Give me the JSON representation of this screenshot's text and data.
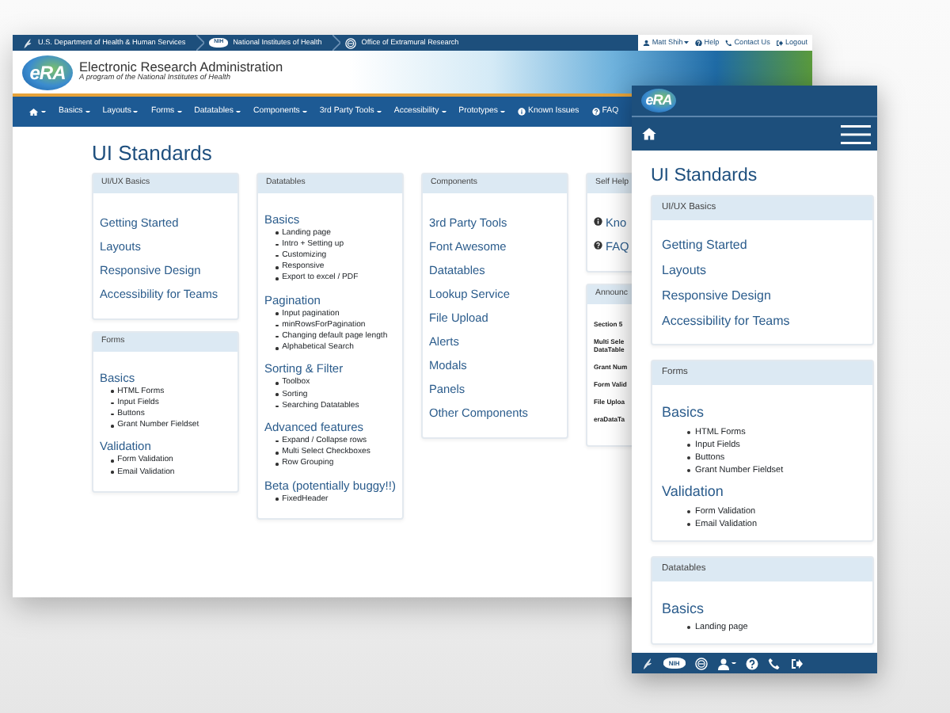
{
  "desktop": {
    "top_bar": {
      "agencies": [
        {
          "kind": "hhs",
          "name": "U.S. Department of Health & Human Services"
        },
        {
          "kind": "nih",
          "badge": "NIH",
          "name": "National Institutes of Health"
        },
        {
          "kind": "oer",
          "name": "Office of Extramural Research"
        }
      ],
      "user_links": [
        {
          "kind": "user",
          "label": "Matt Shih",
          "dropdown": true
        },
        {
          "kind": "help",
          "label": "Help",
          "dropdown": false
        },
        {
          "kind": "phone",
          "label": "Contact Us",
          "dropdown": false
        },
        {
          "kind": "logout",
          "label": "Logout",
          "dropdown": false
        }
      ]
    },
    "header": {
      "logo": "eRA",
      "title": "Electronic Research Administration",
      "subtitle": "A program of the National Institutes of Health"
    },
    "nav": [
      {
        "kind": "home",
        "dropdown": true
      },
      {
        "kind": "text",
        "label": "Basics",
        "dropdown": true
      },
      {
        "kind": "text",
        "label": "Layouts",
        "dropdown": true
      },
      {
        "kind": "text",
        "label": "Forms",
        "dropdown": true
      },
      {
        "kind": "text",
        "label": "Datatables",
        "dropdown": true
      },
      {
        "kind": "text",
        "label": "Components",
        "dropdown": true
      },
      {
        "kind": "text",
        "label": "3rd Party Tools",
        "dropdown": true
      },
      {
        "kind": "text",
        "label": "Accessibility",
        "dropdown": true
      },
      {
        "kind": "text",
        "label": "Prototypes",
        "dropdown": true
      },
      {
        "kind": "info",
        "label": "Known Issues",
        "dropdown": false
      },
      {
        "kind": "help",
        "label": "FAQ",
        "dropdown": false
      }
    ],
    "page_title": "UI Standards",
    "columns": [
      [
        {
          "title": "UI/UX Basics",
          "kind": "links",
          "links": [
            "Getting Started",
            "Layouts",
            "Responsive Design",
            "Accessibility for Teams"
          ]
        },
        {
          "title": "Forms",
          "kind": "sections",
          "sections": [
            {
              "heading": "Basics",
              "items": [
                "HTML Forms",
                "Input Fields",
                "Buttons",
                "Grant Number Fieldset"
              ]
            },
            {
              "heading": "Validation",
              "items": [
                "Form Validation",
                "Email Validation"
              ]
            }
          ]
        }
      ],
      [
        {
          "title": "Datatables",
          "kind": "sections",
          "sections": [
            {
              "heading": "Basics",
              "items": [
                "Landing page",
                "Intro + Setting up",
                "Customizing",
                "Responsive",
                "Export to excel / PDF"
              ]
            },
            {
              "heading": "Pagination",
              "items": [
                "Input pagination",
                "minRowsForPagination",
                "Changing default page length",
                "Alphabetical Search"
              ]
            },
            {
              "heading": "Sorting & Filter",
              "items": [
                "Toolbox",
                "Sorting",
                "Searching Datatables"
              ]
            },
            {
              "heading": "Advanced features",
              "items": [
                "Expand / Collapse rows",
                "Multi Select Checkboxes",
                "Row Grouping"
              ]
            },
            {
              "heading": "Beta (potentially buggy!!)",
              "items": [
                "FixedHeader"
              ]
            }
          ]
        }
      ],
      [
        {
          "title": "Components",
          "kind": "links",
          "links": [
            "3rd Party Tools",
            "Font Awesome",
            "Datatables",
            "Lookup Service",
            "File Upload",
            "Alerts",
            "Modals",
            "Panels",
            "Other Components"
          ]
        }
      ],
      [
        {
          "title": "Self Help",
          "kind": "icon_links",
          "links": [
            {
              "kind": "info",
              "label": "Kno"
            },
            {
              "kind": "help",
              "label": "FAQ"
            }
          ]
        },
        {
          "title": "Announc",
          "kind": "announcements",
          "items": [
            [
              "Section 5"
            ],
            [
              "Multi Sele",
              "DataTable"
            ],
            [
              "Grant Num"
            ],
            [
              "Form Valid"
            ],
            [
              "File Uploa"
            ],
            [
              "eraDataTa"
            ]
          ]
        }
      ]
    ]
  },
  "mobile": {
    "logo": "eRA",
    "page_title": "UI Standards",
    "cards": [
      {
        "title": "UI/UX Basics",
        "kind": "links",
        "links": [
          "Getting Started",
          "Layouts",
          "Responsive Design",
          "Accessibility for Teams"
        ]
      },
      {
        "title": "Forms",
        "kind": "sections",
        "sections": [
          {
            "heading": "Basics",
            "items": [
              "HTML Forms",
              "Input Fields",
              "Buttons",
              "Grant Number Fieldset"
            ]
          },
          {
            "heading": "Validation",
            "items": [
              "Form Validation",
              "Email Validation"
            ]
          }
        ]
      },
      {
        "title": "Datatables",
        "kind": "sections",
        "sections": [
          {
            "heading": "Basics",
            "items": [
              "Landing page"
            ]
          }
        ]
      }
    ],
    "toolbar": [
      {
        "kind": "hhs",
        "dropdown": false
      },
      {
        "kind": "nih",
        "badge": "NIH",
        "dropdown": false
      },
      {
        "kind": "oer",
        "dropdown": false
      },
      {
        "kind": "user",
        "dropdown": true
      },
      {
        "kind": "help",
        "dropdown": false
      },
      {
        "kind": "phone",
        "dropdown": false
      },
      {
        "kind": "logout",
        "dropdown": false
      }
    ]
  }
}
